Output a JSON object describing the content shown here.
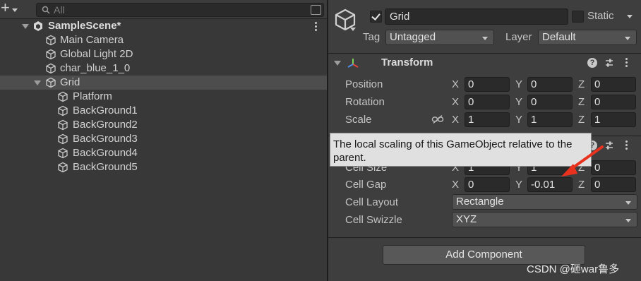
{
  "hierarchy": {
    "add_symbol": "+",
    "search_placeholder": "All",
    "scene": "SampleScene*",
    "items": [
      {
        "label": "Main Camera"
      },
      {
        "label": "Global Light 2D"
      },
      {
        "label": "char_blue_1_0"
      },
      {
        "label": "Grid"
      },
      {
        "label": "Platform"
      },
      {
        "label": "BackGround1"
      },
      {
        "label": "BackGround2"
      },
      {
        "label": "BackGround3"
      },
      {
        "label": "BackGround4"
      },
      {
        "label": "BackGround5"
      }
    ],
    "selected_item": "Grid"
  },
  "inspector": {
    "object_name": "Grid",
    "active": true,
    "static_label": "Static",
    "static": false,
    "tag_label": "Tag",
    "tag_value": "Untagged",
    "layer_label": "Layer",
    "layer_value": "Default",
    "transform": {
      "title": "Transform",
      "rows": [
        {
          "label": "Position",
          "x": "0",
          "y": "0",
          "z": "0"
        },
        {
          "label": "Rotation",
          "x": "0",
          "y": "0",
          "z": "0"
        },
        {
          "label": "Scale",
          "x": "1",
          "y": "1",
          "z": "1"
        }
      ]
    },
    "axis_labels": {
      "x": "X",
      "y": "Y",
      "z": "Z"
    },
    "grid": {
      "cell_size": {
        "label": "Cell Size",
        "x": "1",
        "y": "1",
        "z": "0"
      },
      "cell_gap": {
        "label": "Cell Gap",
        "x": "0",
        "y": "-0.01",
        "z": "0"
      },
      "cell_layout": {
        "label": "Cell Layout",
        "value": "Rectangle"
      },
      "cell_swizzle": {
        "label": "Cell Swizzle",
        "value": "XYZ"
      }
    },
    "tooltip": "The local scaling of this GameObject relative to the parent.",
    "add_component": "Add Component",
    "help_glyph": "?"
  },
  "watermark": "CSDN @砸war鲁多",
  "colors": {
    "panel_bg": "#383838",
    "inspector_bg": "#3e3e3e",
    "field_bg": "#2a2a2a",
    "selection_bg": "#4d4d4d",
    "arrow_red": "#e8321e",
    "tooltip_bg": "#e0e0e0"
  },
  "icons": [
    "plus-icon",
    "search-icon",
    "scene-unity-icon",
    "gameobject-cube-icon",
    "transform-axes-icon",
    "help-icon",
    "presets-icon",
    "kebab-menu-icon",
    "link-scale-icon"
  ]
}
